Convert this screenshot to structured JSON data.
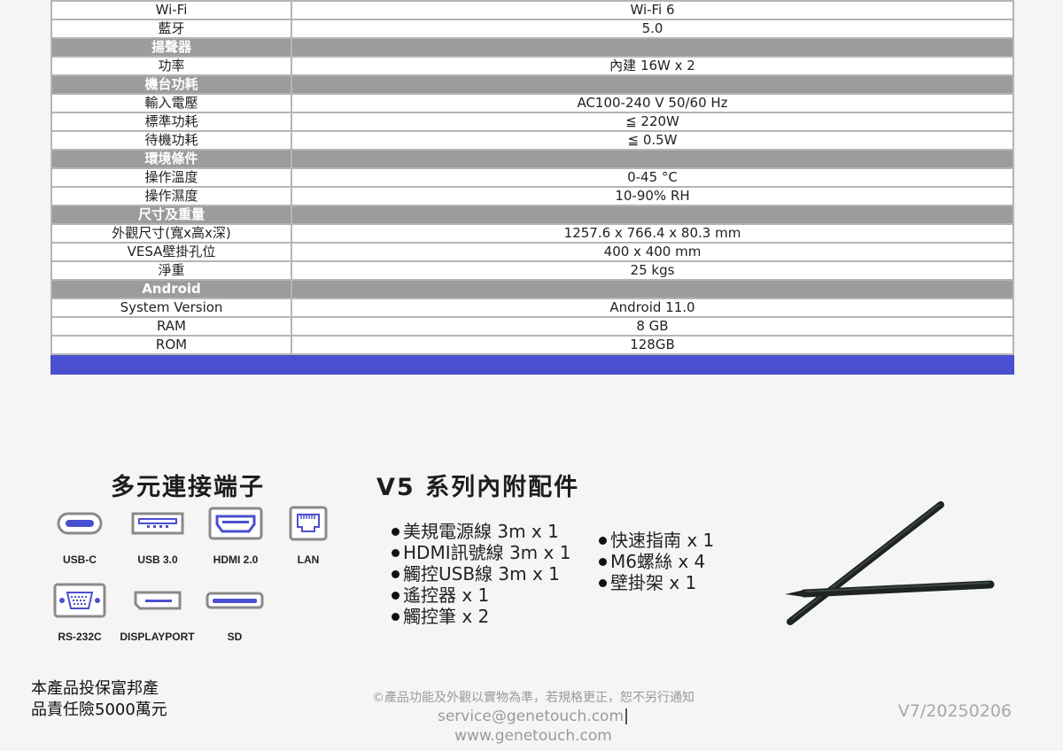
{
  "spec_rows": [
    {
      "type": "row",
      "label": "Wi-Fi",
      "value": "Wi-Fi 6"
    },
    {
      "type": "row",
      "label": "藍牙",
      "value": "5.0"
    },
    {
      "type": "section",
      "label": "揚聲器"
    },
    {
      "type": "row",
      "label": "功率",
      "value": "內建 16W x 2"
    },
    {
      "type": "section",
      "label": "機台功耗"
    },
    {
      "type": "row",
      "label": "輸入電壓",
      "value": "AC100-240 V  50/60 Hz"
    },
    {
      "type": "row",
      "label": "標準功耗",
      "value": "≦ 220W"
    },
    {
      "type": "row",
      "label": "待機功耗",
      "value": "≦ 0.5W"
    },
    {
      "type": "section",
      "label": "環境條件"
    },
    {
      "type": "row",
      "label": "操作溫度",
      "value": "0-45 °C"
    },
    {
      "type": "row",
      "label": "操作濕度",
      "value": "10-90% RH"
    },
    {
      "type": "section",
      "label": "尺寸及重量"
    },
    {
      "type": "row",
      "label": "外觀尺寸(寬x高x深)",
      "value": "1257.6 x 766.4 x 80.3 mm"
    },
    {
      "type": "row",
      "label": "VESA壁掛孔位",
      "value": "400 x 400 mm"
    },
    {
      "type": "row",
      "label": "淨重",
      "value": "25 kgs"
    },
    {
      "type": "section",
      "label": "Android"
    },
    {
      "type": "row",
      "label": "System Version",
      "value": "Android 11.0"
    },
    {
      "type": "row",
      "label": "RAM",
      "value": "8 GB"
    },
    {
      "type": "row",
      "label": "ROM",
      "value": "128GB"
    }
  ],
  "colors": {
    "section_bg": "#9c9c9c",
    "accent_bar": "#4a50cf",
    "icon_blue": "#4a50cf"
  },
  "connectors": {
    "heading": "多元連接端子",
    "ports": [
      {
        "label": "USB-C",
        "icon": "usb-c-icon"
      },
      {
        "label": "USB 3.0",
        "icon": "usb-a-icon"
      },
      {
        "label": "HDMI 2.0",
        "icon": "hdmi-icon"
      },
      {
        "label": "LAN",
        "icon": "lan-icon"
      },
      {
        "label": "RS-232C",
        "icon": "rs232-icon"
      },
      {
        "label": "DISPLAYPORT",
        "icon": "displayport-icon"
      },
      {
        "label": "SD",
        "icon": "sd-card-icon"
      }
    ]
  },
  "accessories": {
    "heading": "V5 系列內附配件",
    "col1": [
      "美規電源線 3m x 1",
      "HDMI訊號線 3m x 1",
      "觸控USB線 3m x 1",
      "遙控器 x 1",
      "觸控筆 x 2"
    ],
    "col2": [
      "快速指南 x 1",
      "M6螺絲 x 4",
      "壁掛架 x 1"
    ],
    "image": "stylus-pens"
  },
  "footer": {
    "warranty_line1": "本產品投保富邦產",
    "warranty_line2": "品責任險5000萬元",
    "note": "©產品功能及外觀以實物為準，若規格更正，恕不另行通知",
    "email": "service@genetouch.com",
    "website": "www.genetouch.com",
    "version": "V7/20250206"
  }
}
